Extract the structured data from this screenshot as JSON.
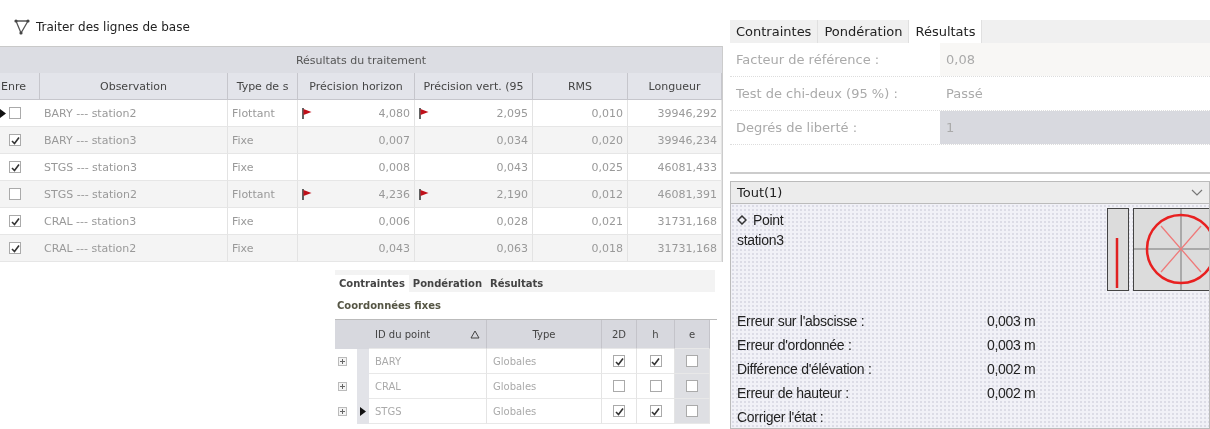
{
  "toolbar": {
    "title": "Traiter des lignes de base"
  },
  "baselines": {
    "group_header": "Résultats du traitement",
    "columns": [
      "Enre",
      "Observation",
      "Type de s",
      "Précision horizon",
      "Précision vert. (95",
      "RMS",
      "Longueur"
    ],
    "rows": [
      {
        "current": true,
        "checked": false,
        "observation": "BARY --- station2",
        "type": "Flottant",
        "horiz_flag": true,
        "horizontal": "4,080",
        "vert_flag": true,
        "vertical": "2,095",
        "rms": "0,010",
        "length": "39946,292"
      },
      {
        "current": false,
        "checked": true,
        "observation": "BARY --- station3",
        "type": "Fixe",
        "horiz_flag": false,
        "horizontal": "0,007",
        "vert_flag": false,
        "vertical": "0,034",
        "rms": "0,020",
        "length": "39946,234"
      },
      {
        "current": false,
        "checked": true,
        "observation": "STGS --- station3",
        "type": "Fixe",
        "horiz_flag": false,
        "horizontal": "0,008",
        "vert_flag": false,
        "vertical": "0,043",
        "rms": "0,025",
        "length": "46081,433"
      },
      {
        "current": false,
        "checked": false,
        "observation": "STGS --- station2",
        "type": "Flottant",
        "horiz_flag": true,
        "horizontal": "4,236",
        "vert_flag": true,
        "vertical": "2,190",
        "rms": "0,012",
        "length": "46081,391"
      },
      {
        "current": false,
        "checked": true,
        "observation": "CRAL --- station3",
        "type": "Fixe",
        "horiz_flag": false,
        "horizontal": "0,006",
        "vert_flag": false,
        "vertical": "0,028",
        "rms": "0,021",
        "length": "31731,168"
      },
      {
        "current": false,
        "checked": true,
        "observation": "CRAL --- station2",
        "type": "Fixe",
        "horiz_flag": false,
        "horizontal": "0,043",
        "vert_flag": false,
        "vertical": "0,063",
        "rms": "0,018",
        "length": "31731,168"
      }
    ]
  },
  "adjust_tabs": [
    {
      "label": "Contraintes",
      "selected": true
    },
    {
      "label": "Pondération",
      "selected": false
    },
    {
      "label": "Résultats",
      "selected": false
    }
  ],
  "fixed_coords": {
    "title": "Coordonnées fixes",
    "columns": [
      "ID du point",
      "Type",
      "2D",
      "h",
      "e"
    ],
    "rows": [
      {
        "expanded": false,
        "current": false,
        "id": "BARY",
        "type": "Globales",
        "2d": true,
        "h": true,
        "e": false
      },
      {
        "expanded": false,
        "current": false,
        "id": "CRAL",
        "type": "Globales",
        "2d": false,
        "h": false,
        "e": false
      },
      {
        "expanded": false,
        "current": true,
        "id": "STGS",
        "type": "Globales",
        "2d": true,
        "h": true,
        "e": false
      }
    ]
  },
  "result_tabs": [
    {
      "label": "Contraintes",
      "selected": false
    },
    {
      "label": "Pondération",
      "selected": false
    },
    {
      "label": "Résultats",
      "selected": true
    }
  ],
  "statistics": [
    {
      "label": "Facteur de référence :",
      "value": "0,08",
      "selected": false
    },
    {
      "label": "Test de chi-deux (95 %) :",
      "value": "Passé",
      "selected": false
    },
    {
      "label": "Degrés de liberté :",
      "value": "1",
      "selected": true
    }
  ],
  "point_panel": {
    "filter": "Tout(1)",
    "kind_label": "Point",
    "name": "station3",
    "measures": [
      {
        "label": "Erreur sur l'abscisse :",
        "value": "0,003 m"
      },
      {
        "label": "Erreur d'ordonnée :",
        "value": "0,003 m"
      },
      {
        "label": "Différence d'élévation :",
        "value": "0,002 m"
      },
      {
        "label": "Erreur de hauteur :",
        "value": "0,002 m"
      },
      {
        "label": "Corriger l'état :"
      }
    ]
  }
}
